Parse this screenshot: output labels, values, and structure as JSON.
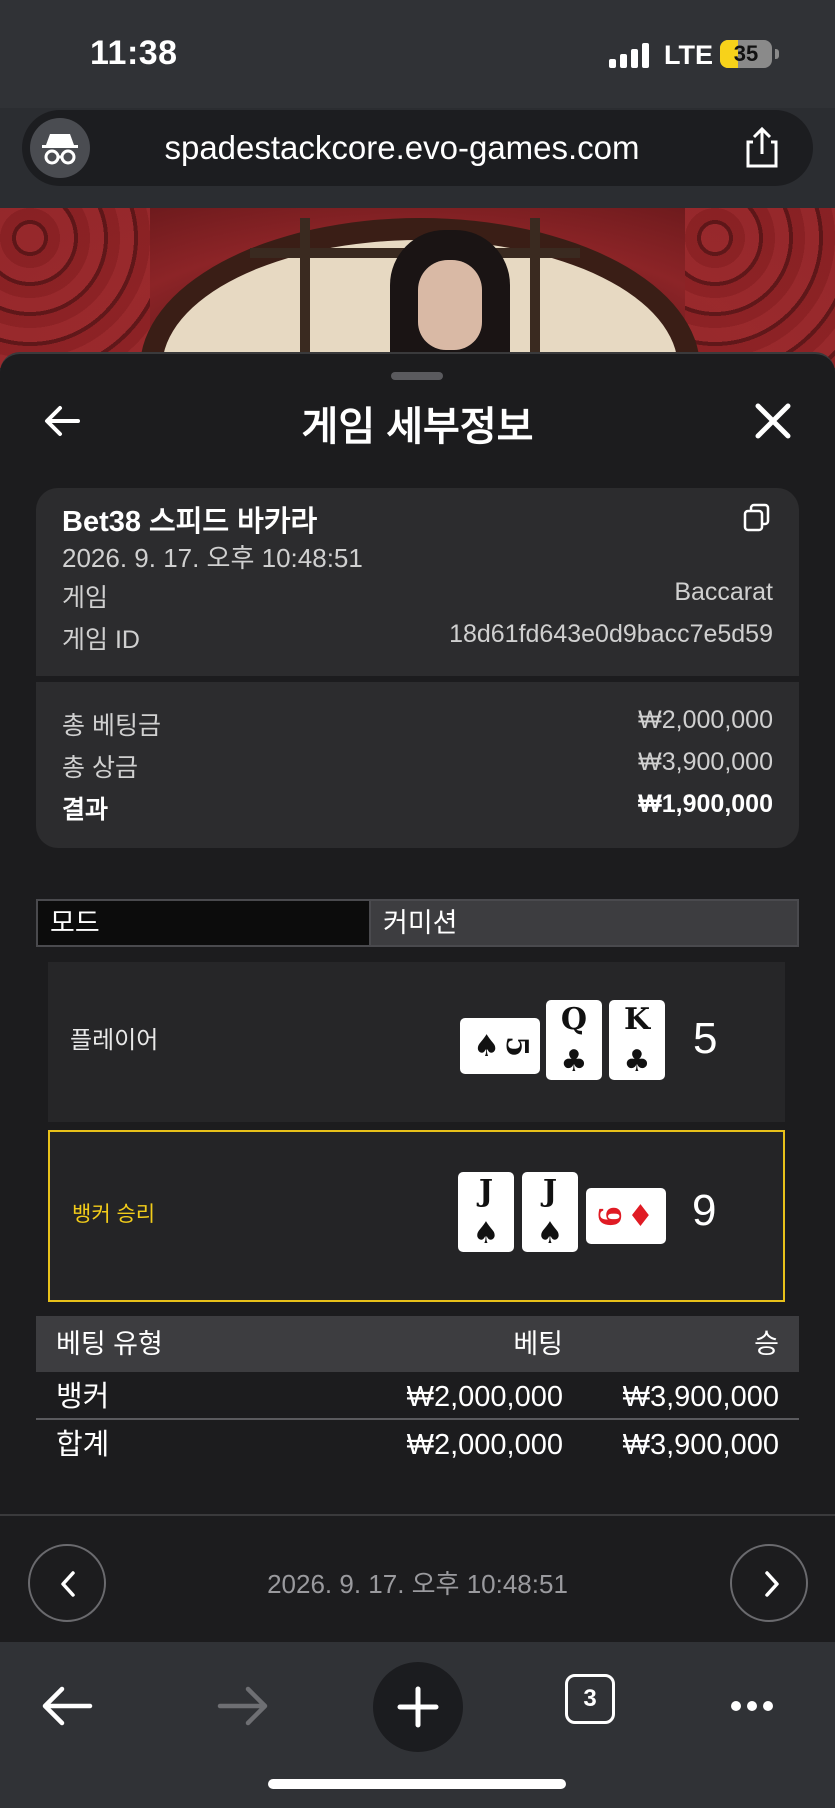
{
  "status": {
    "time": "11:38",
    "network": "LTE",
    "battery": "35",
    "battery_level": 0.35
  },
  "browser": {
    "url": "spadestackcore.evo-games.com",
    "tab_count": "3"
  },
  "sheet": {
    "title": "게임 세부정보",
    "table_name": "Bet38 스피드 바카라",
    "timestamp": "2026. 9. 17. 오후 10:48:51",
    "game_label": "게임",
    "game_value": "Baccarat",
    "game_id_label": "게임 ID",
    "game_id_value": "18d61fd643e0d9bacc7e5d59",
    "total_bet_label": "총 베팅금",
    "total_bet_value": "₩2,000,000",
    "total_win_label": "총 상금",
    "total_win_value": "₩3,900,000",
    "result_label": "결과",
    "result_value": "₩1,900,000"
  },
  "mode": {
    "left": "모드",
    "right": "커미션"
  },
  "player": {
    "label": "플레이어",
    "score": "5",
    "cards": [
      {
        "rank": "5",
        "suit": "♠",
        "color": "black",
        "sideways": true
      },
      {
        "rank": "Q",
        "suit": "♣",
        "color": "black"
      },
      {
        "rank": "K",
        "suit": "♣",
        "color": "black"
      }
    ]
  },
  "banker": {
    "label": "뱅커 승리",
    "score": "9",
    "cards": [
      {
        "rank": "J",
        "suit": "♠",
        "color": "black"
      },
      {
        "rank": "J",
        "suit": "♠",
        "color": "black"
      },
      {
        "rank": "9",
        "suit": "♦",
        "color": "red",
        "sideways": true
      }
    ]
  },
  "bet_table": {
    "headers": [
      "베팅 유형",
      "베팅",
      "승"
    ],
    "rows": [
      [
        "뱅커",
        "₩2,000,000",
        "₩3,900,000"
      ],
      [
        "합계",
        "₩2,000,000",
        "₩3,900,000"
      ]
    ]
  },
  "footer": {
    "date": "2026. 9. 17. 오후 10:48:51"
  },
  "colors": {
    "accent": "#f2cc1a",
    "card_red": "#e01b24"
  }
}
